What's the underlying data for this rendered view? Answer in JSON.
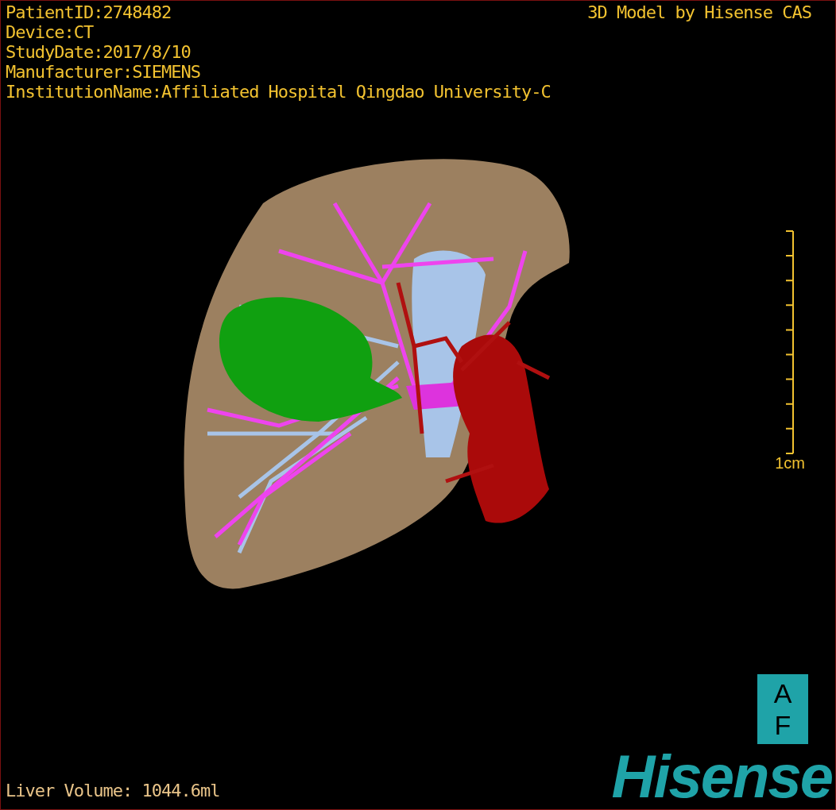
{
  "overlay_info": [
    {
      "text": "PatientID:2748482"
    },
    {
      "text": "Device:CT"
    },
    {
      "text": "StudyDate:2017/8/10"
    },
    {
      "text": "Manufacturer:SIEMENS"
    },
    {
      "text": "InstitutionName:Affiliated Hospital Qingdao University-C"
    }
  ],
  "model_credit": "3D Model by Hisense CAS",
  "scale_bar": {
    "label": "1cm"
  },
  "badge": {
    "top": "A",
    "bottom": "F"
  },
  "logo": "Hisense",
  "liver_volume": "Liver Volume: 1044.6ml"
}
